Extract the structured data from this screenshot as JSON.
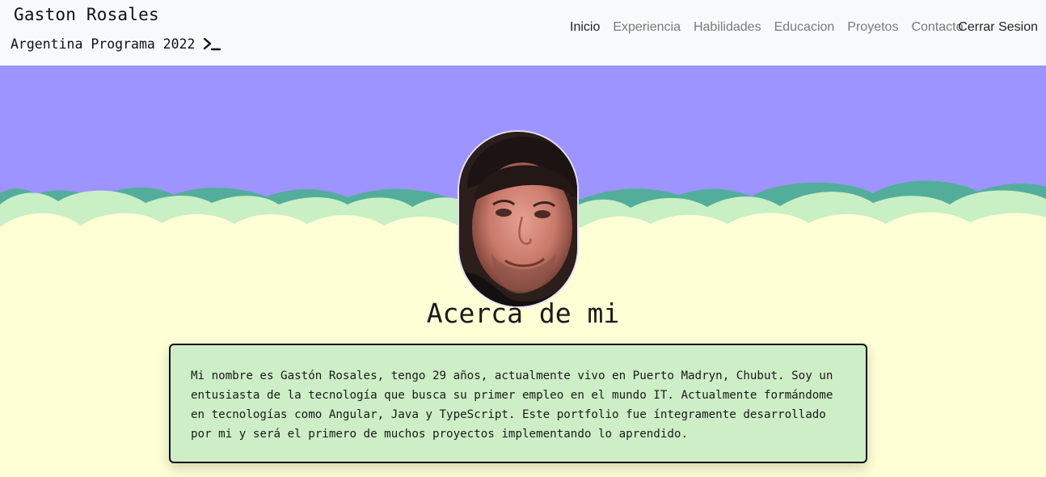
{
  "header": {
    "name": "Gaston Rosales",
    "subtitle": "Argentina Programa 2022",
    "terminal_icon": "terminal-prompt-icon"
  },
  "nav": {
    "items": [
      {
        "label": "Inicio",
        "active": true
      },
      {
        "label": "Experiencia",
        "active": false
      },
      {
        "label": "Habilidades",
        "active": false
      },
      {
        "label": "Educacion",
        "active": false
      },
      {
        "label": "Proyetos",
        "active": false
      },
      {
        "label": "Contacto",
        "active": false
      }
    ],
    "logout_label": "Cerrar Sesion"
  },
  "about": {
    "title": "Acerca de mi",
    "text": "Mi nombre es Gastón Rosales, tengo 29 años, actualmente vivo en Puerto Madryn, Chubut. Soy un entusiasta de la tecnología que busca su primer empleo en el mundo IT. Actualmente formándome en tecnologías como Angular, Java y TypeScript. Este portfolio fue íntegramente desarrollado por mi y será el primero de muchos proyectos implementando lo aprendido."
  },
  "colors": {
    "navbar_bg": "#f8f9fa",
    "hero_sky": "#9d94ff",
    "wave_dark": "#52ae9b",
    "wave_light": "#c9efc4",
    "hero_ground": "#ffffd6",
    "card_bg": "#cdeec6"
  }
}
